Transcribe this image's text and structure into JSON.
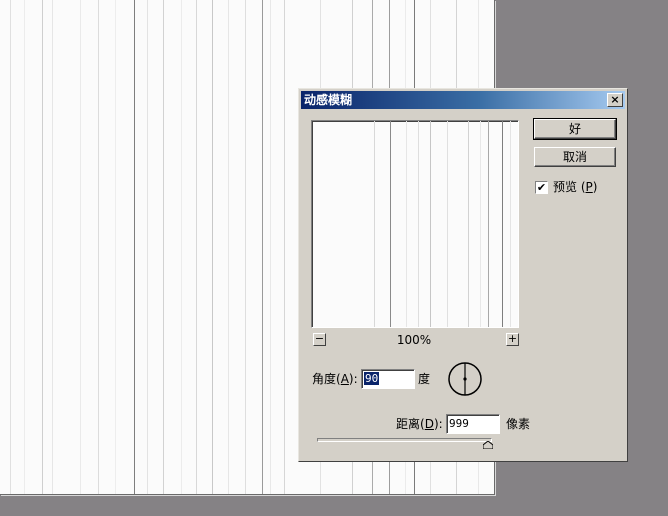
{
  "dialog": {
    "title": "动感模糊",
    "close_glyph": "×",
    "ok_label": "好",
    "cancel_label": "取消",
    "preview": {
      "label_prefix": "预览 (",
      "label_key": "P",
      "label_suffix": ")",
      "checked": true,
      "check_glyph": "✔"
    },
    "zoom": {
      "out_glyph": "−",
      "in_glyph": "+",
      "level": "100%"
    },
    "angle": {
      "label_prefix": "角度(",
      "label_key": "A",
      "label_suffix": "):",
      "value": "90",
      "unit": "度"
    },
    "distance": {
      "label_prefix": "距离(",
      "label_key": "D",
      "label_suffix": "):",
      "value": "999",
      "unit": "像素"
    }
  },
  "colors": {
    "titlebar_start": "#0a246a",
    "titlebar_end": "#a6caf0",
    "dialog_face": "#d4d0c8",
    "workspace": "#858285",
    "canvas": "#fbfbfb"
  }
}
